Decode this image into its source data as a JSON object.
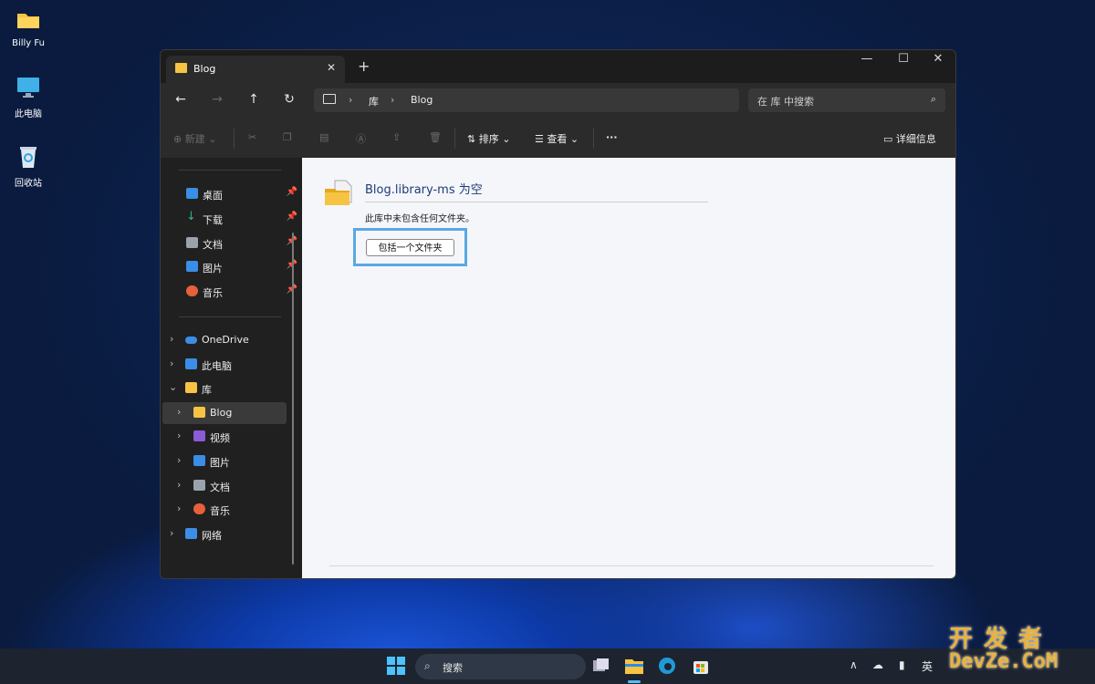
{
  "desktop": {
    "icons": [
      {
        "label": "Billy Fu",
        "icon": "folder-icon"
      },
      {
        "label": "此电脑",
        "icon": "monitor-icon"
      },
      {
        "label": "回收站",
        "icon": "recycle-bin-icon"
      }
    ]
  },
  "window": {
    "tab_title": "Blog",
    "new_tab": "+",
    "controls": {
      "minimize": "—",
      "maximize": "☐",
      "close": "✕"
    },
    "address": {
      "segments": [
        "库",
        "Blog"
      ],
      "separator": "›"
    },
    "search": {
      "placeholder": "在 库 中搜索"
    },
    "toolbar": {
      "new": "新建",
      "sort": "排序",
      "view": "查看",
      "more": "···",
      "details": "详细信息"
    },
    "sidebar": {
      "quick_access": [
        {
          "label": "桌面",
          "icon": "desktop-icon",
          "color": "#3a8ee6"
        },
        {
          "label": "下载",
          "icon": "download-icon",
          "color": "#2fb37a"
        },
        {
          "label": "文档",
          "icon": "document-icon",
          "color": "#9aa3ad"
        },
        {
          "label": "图片",
          "icon": "picture-icon",
          "color": "#3a8ee6"
        },
        {
          "label": "音乐",
          "icon": "music-icon",
          "color": "#e5603b"
        }
      ],
      "tree": [
        {
          "label": "OneDrive",
          "icon": "cloud-icon",
          "color": "#3a8ee6",
          "expanded": false
        },
        {
          "label": "此电脑",
          "icon": "monitor-icon",
          "color": "#3a8ee6",
          "expanded": false
        },
        {
          "label": "库",
          "icon": "library-icon",
          "color": "#f6c343",
          "expanded": true
        },
        {
          "label": "Blog",
          "icon": "library-folder-icon",
          "color": "#f6c343",
          "selected": true
        },
        {
          "label": "视频",
          "icon": "video-icon",
          "color": "#8a5cd6"
        },
        {
          "label": "图片",
          "icon": "picture-icon",
          "color": "#3a8ee6"
        },
        {
          "label": "文档",
          "icon": "document-icon",
          "color": "#9aa3ad"
        },
        {
          "label": "音乐",
          "icon": "music-icon",
          "color": "#e5603b"
        },
        {
          "label": "网络",
          "icon": "network-icon",
          "color": "#3a8ee6",
          "expanded": false
        }
      ]
    },
    "content": {
      "title": "Blog.library-ms 为空",
      "description": "此库中未包含任何文件夹。",
      "include_button": "包括一个文件夹"
    }
  },
  "taskbar": {
    "search_label": "搜索",
    "tray": {
      "ime": "英",
      "chevron": "∧"
    }
  },
  "watermark": {
    "line1": "开发者",
    "line2": "DevZe.CoM"
  }
}
